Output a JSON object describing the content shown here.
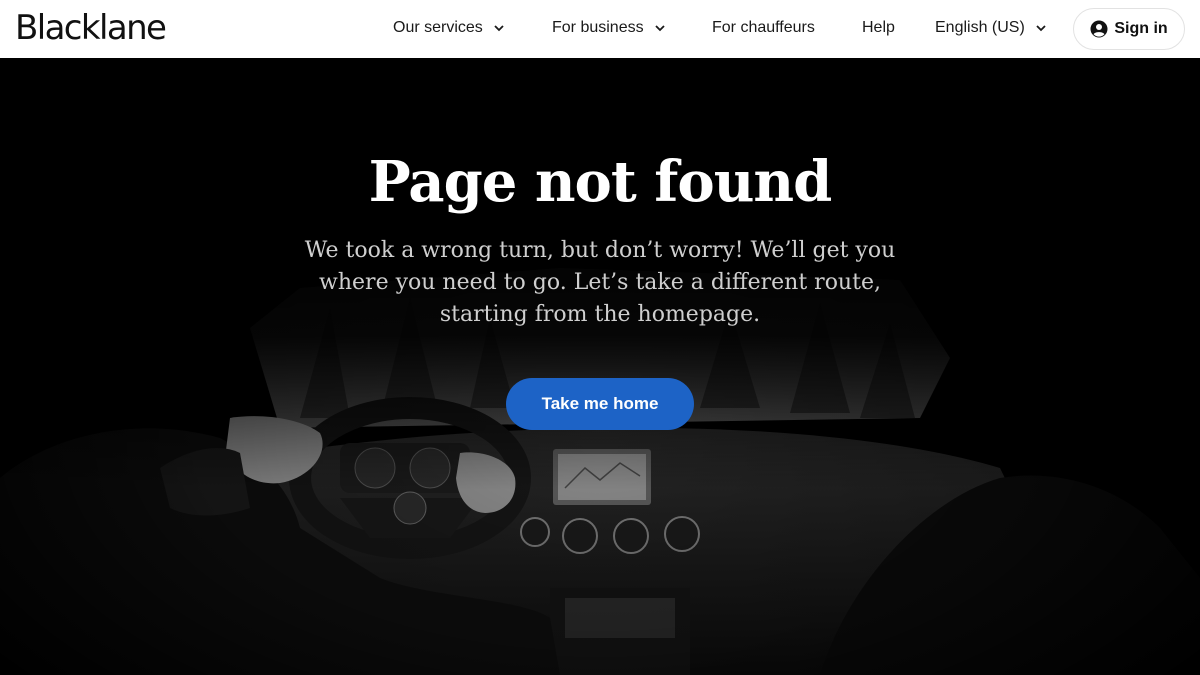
{
  "header": {
    "logo": "Blacklane",
    "nav": {
      "services": "Our services",
      "business": "For business",
      "chauffeurs": "For chauffeurs",
      "help": "Help",
      "language": "English (US)"
    },
    "signin_label": "Sign in"
  },
  "hero": {
    "title": "Page not found",
    "subtitle": "We took a wrong turn, but don’t worry! We’ll get you where you need to go. Let’s take a different route, starting from the homepage.",
    "cta_label": "Take me home",
    "image": "car-interior-photo"
  },
  "colors": {
    "header_bg": "#ffffff",
    "hero_bg": "#000000",
    "accent": "#1d63c6"
  }
}
